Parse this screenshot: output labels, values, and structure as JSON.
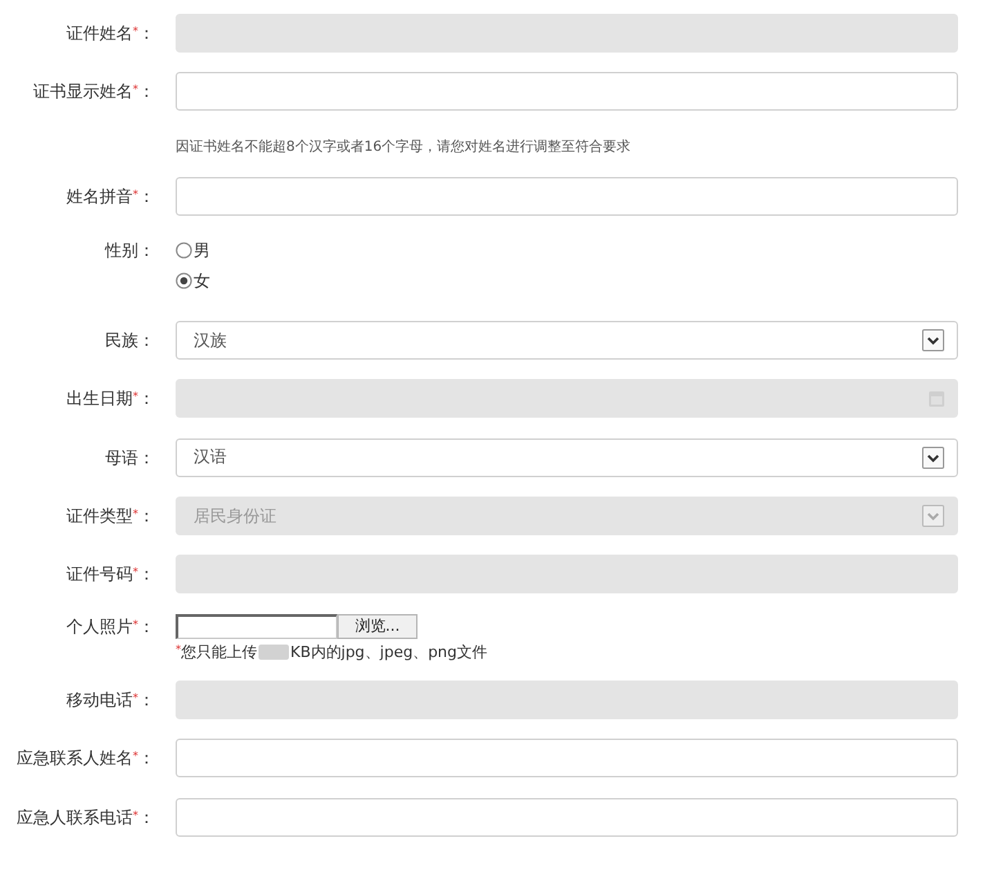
{
  "fields": [
    {
      "kind": "text",
      "label": "证件姓名$^{*}$：",
      "disabled": true
    },
    {
      "kind": "text",
      "label": "证书显示姓名$^{*}$：",
      "disabled": false,
      "hint": "因证书姓名不能超8个汉字或者16个字母，请您对姓名进行调整至符合要求"
    },
    {
      "kind": "text",
      "label": "姓名拼音$^{*}$：",
      "disabled": false
    },
    {
      "kind": "radio",
      "label": "性别：",
      "options": [
        {
          "label": "男",
          "selected": false
        },
        {
          "label": "女",
          "selected": true
        }
      ]
    },
    {
      "kind": "select",
      "label": "民族：",
      "value": "汉族",
      "disabled": false
    },
    {
      "kind": "date",
      "label": "出生日期$^{*}$：",
      "disabled": true
    },
    {
      "kind": "select",
      "label": "母语：",
      "value": "汉语",
      "disabled": false
    },
    {
      "kind": "select",
      "label": "证件类型$^{*}$：",
      "value": "居民身份证",
      "disabled": true
    },
    {
      "kind": "text",
      "label": "证件号码$^{*}$：",
      "disabled": true
    },
    {
      "kind": "file",
      "label": "个人照片$^{*}$：",
      "button": "浏览...",
      "note": {
        "before": "$^{*}$您只能上传",
        "after": "KB内的jpg、jpeg、png文件"
      }
    },
    {
      "kind": "text",
      "label": "移动电话$^{*}$：",
      "disabled": true
    },
    {
      "kind": "text",
      "label": "应急联系人姓名$^{*}$：",
      "disabled": false
    },
    {
      "kind": "text",
      "label": "应急人联系电话$^{*}$：",
      "disabled": false
    }
  ]
}
